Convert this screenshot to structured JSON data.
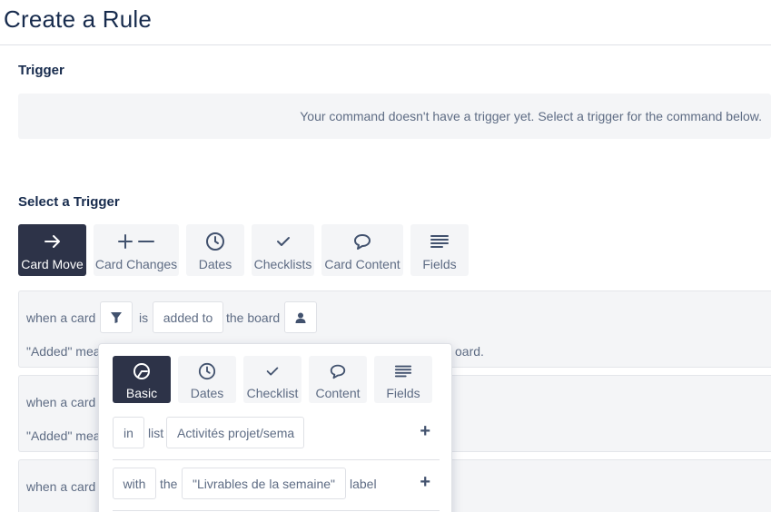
{
  "page": {
    "title": "Create a Rule"
  },
  "trigger": {
    "heading": "Trigger",
    "empty_message": "Your command doesn't have a trigger yet. Select a trigger for the command below."
  },
  "select_trigger": {
    "heading": "Select a Trigger",
    "tabs": [
      {
        "label": "Card Move",
        "icon": "arrow-right-icon",
        "active": true
      },
      {
        "label": "Card Changes",
        "icon": "plus-minus-icon",
        "active": false
      },
      {
        "label": "Dates",
        "icon": "clock-icon",
        "active": false
      },
      {
        "label": "Checklists",
        "icon": "check-icon",
        "active": false
      },
      {
        "label": "Card Content",
        "icon": "comment-icon",
        "active": false
      },
      {
        "label": "Fields",
        "icon": "lines-icon",
        "active": false
      }
    ]
  },
  "rows": [
    {
      "prefix": "when a card",
      "is": "is",
      "action_value": "added to",
      "suffix": "the board",
      "note_start": "\"Added\" mea",
      "note_end": "oard."
    },
    {
      "prefix": "when a card",
      "note_start": "\"Added\" mea"
    },
    {
      "prefix": "when a card"
    }
  ],
  "popover": {
    "tabs": [
      {
        "label": "Basic",
        "icon": "badge-icon",
        "active": true
      },
      {
        "label": "Dates",
        "icon": "clock-icon",
        "active": false
      },
      {
        "label": "Checklist",
        "icon": "check-icon",
        "active": false
      },
      {
        "label": "Content",
        "icon": "comment-icon",
        "active": false
      },
      {
        "label": "Fields",
        "icon": "lines-icon",
        "active": false
      }
    ],
    "filters": [
      {
        "qualifier": "in",
        "word": "list",
        "value": "Activités projet/sema",
        "add": "+"
      },
      {
        "qualifier": "with",
        "word": "the",
        "value": "\"Livrables de la semaine\"",
        "suffix": "label",
        "add": "+"
      }
    ]
  },
  "colors": {
    "active_tab": "#2d3348",
    "panel_bg": "#f4f5f7",
    "text_muted": "#5e6c84"
  }
}
